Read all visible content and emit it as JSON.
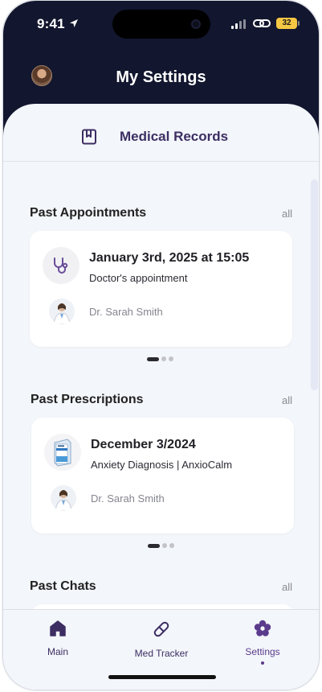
{
  "status_bar": {
    "time": "9:41",
    "battery": "32"
  },
  "header": {
    "title": "My Settings"
  },
  "records_tab": {
    "label": "Medical Records"
  },
  "sections": {
    "appointments": {
      "title": "Past Appointments",
      "all_label": "all",
      "card": {
        "title": "January 3rd, 2025 at 15:05",
        "subtitle": "Doctor's appointment",
        "doctor": "Dr. Sarah Smith"
      }
    },
    "prescriptions": {
      "title": "Past Prescriptions",
      "all_label": "all",
      "card": {
        "title": "December 3/2024",
        "subtitle": "Anxiety Diagnosis | AnxioCalm",
        "doctor": "Dr. Sarah Smith"
      }
    },
    "chats": {
      "title": "Past Chats",
      "all_label": "all"
    }
  },
  "bottom_nav": {
    "items": [
      {
        "label": "Main",
        "icon": "home-icon"
      },
      {
        "label": "Med Tracker",
        "icon": "pill-icon"
      },
      {
        "label": "Settings",
        "icon": "flower-settings-icon",
        "active": true
      }
    ]
  },
  "colors": {
    "header_bg": "#12162e",
    "accent": "#3c2e63",
    "background": "#f3f6fa"
  }
}
